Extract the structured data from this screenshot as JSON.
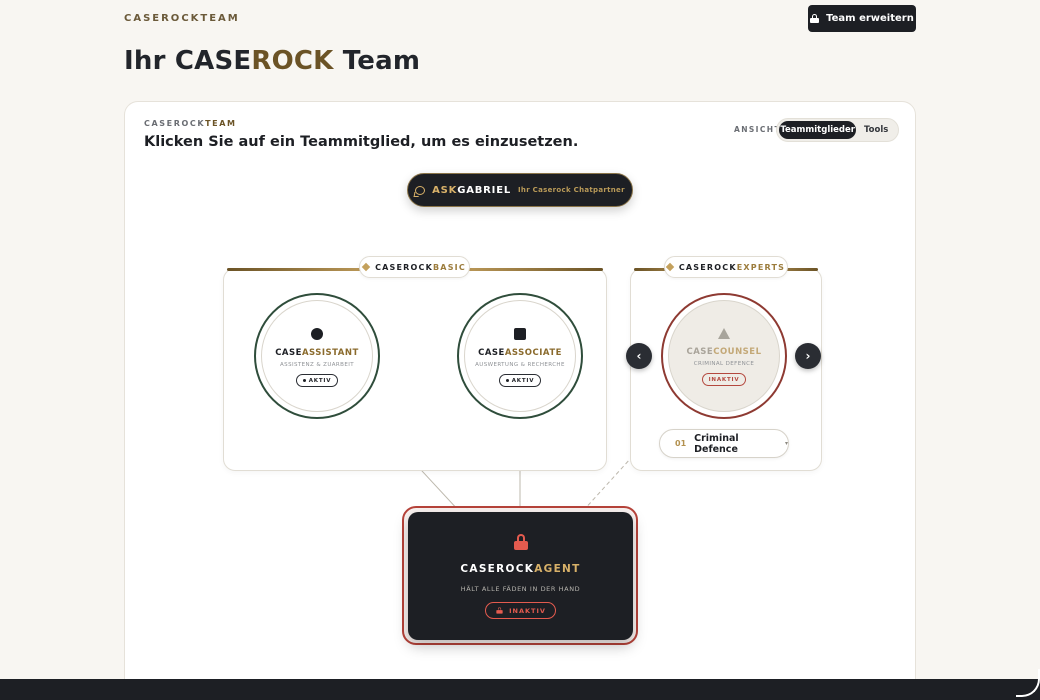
{
  "header": {
    "brand": "CASEROCKTEAM",
    "expand_button": "Team erweitern"
  },
  "page": {
    "title_prefix": "Ihr CASE",
    "title_accent": "ROCK",
    "title_suffix": " Team"
  },
  "panel": {
    "eyebrow_prefix": "CASEROCK",
    "eyebrow_accent": "TEAM",
    "subtitle": "Klicken Sie auf ein Teammitglied, um es einzusetzen.",
    "view_label": "ANSICHT",
    "view_options": [
      "Teammitglieder",
      "Tools"
    ],
    "view_selected": "Teammitglieder"
  },
  "ask": {
    "name_accent": "ASK",
    "name_rest": "GABRIEL",
    "tagline": "Ihr Caserock Chatpartner"
  },
  "groups": {
    "basic": {
      "prefix": "CASEROCK",
      "accent": "BASIC"
    },
    "experts": {
      "prefix": "CASEROCK",
      "accent": "EXPERTS"
    }
  },
  "members": [
    {
      "prefix": "CASE",
      "accent": "ASSISTANT",
      "subtitle": "ASSISTENZ & ZUARBEIT",
      "status": "AKTIV",
      "icon": "circle-icon"
    },
    {
      "prefix": "CASE",
      "accent": "ASSOCIATE",
      "subtitle": "AUSWERTUNG & RECHERCHE",
      "status": "AKTIV",
      "icon": "square-icon"
    },
    {
      "prefix": "CASE",
      "accent": "COUNSEL",
      "subtitle": "CRIMINAL DEFENCE",
      "status": "INAKTIV",
      "icon": "triangle-icon"
    }
  ],
  "carousel": {
    "prev": "‹",
    "next": "›"
  },
  "specialty": {
    "number": "01",
    "label": "Criminal Defence",
    "caret": "▾"
  },
  "agent": {
    "prefix": "CASEROCK",
    "accent": "AGENT",
    "subtitle": "HÄLT ALLE FÄDEN IN DER HAND",
    "status": "INAKTIV"
  },
  "colors": {
    "dark": "#1d1f24",
    "gold": "#d8b169",
    "bronze": "#6b5326",
    "active_ring": "#2f4d3b",
    "inactive_red": "#b7433a",
    "background": "#f8f6f2"
  }
}
